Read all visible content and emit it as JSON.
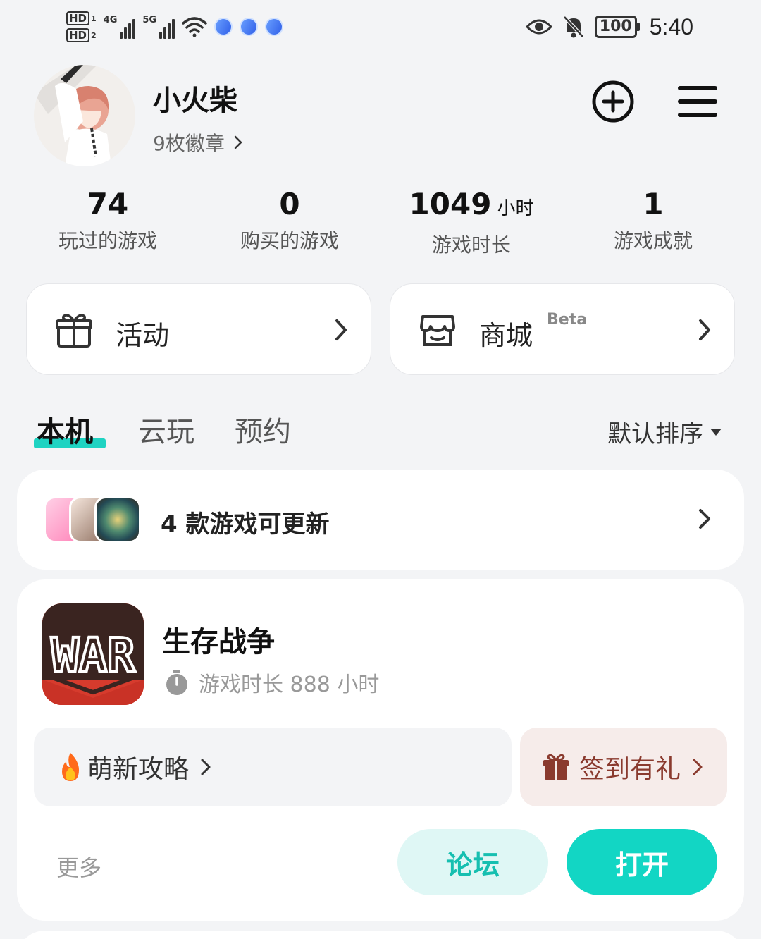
{
  "status_bar": {
    "hd1": "HD",
    "hd1_sub": "1",
    "hd2": "HD",
    "hd2_sub": "2",
    "net1": "4G",
    "net2": "5G",
    "battery": "100",
    "time": "5:40"
  },
  "profile": {
    "name": "小火柴",
    "badges": "9枚徽章"
  },
  "stats": [
    {
      "value": "74",
      "unit": "",
      "label": "玩过的游戏"
    },
    {
      "value": "0",
      "unit": "",
      "label": "购买的游戏"
    },
    {
      "value": "1049",
      "unit": "小时",
      "label": "游戏时长"
    },
    {
      "value": "1",
      "unit": "",
      "label": "游戏成就"
    }
  ],
  "entries": {
    "activity": "活动",
    "mall": "商城",
    "mall_badge": "Beta"
  },
  "tabs": [
    "本机",
    "云玩",
    "预约"
  ],
  "sort_label": "默认排序",
  "updates": {
    "text": "4 款游戏可更新"
  },
  "game": {
    "name": "生存战争",
    "playtime": "游戏时长 888 小时",
    "guide": "萌新攻略",
    "checkin": "签到有礼",
    "more": "更多",
    "forum": "论坛",
    "open": "打开",
    "icon_text": "WAR"
  },
  "colors": {
    "accent": "#12d6c4",
    "accent_light": "#dff7f5",
    "game_icon_red": "#d63b2d",
    "checkin_bg": "#f6ecea",
    "checkin_text": "#8a3a2e"
  }
}
